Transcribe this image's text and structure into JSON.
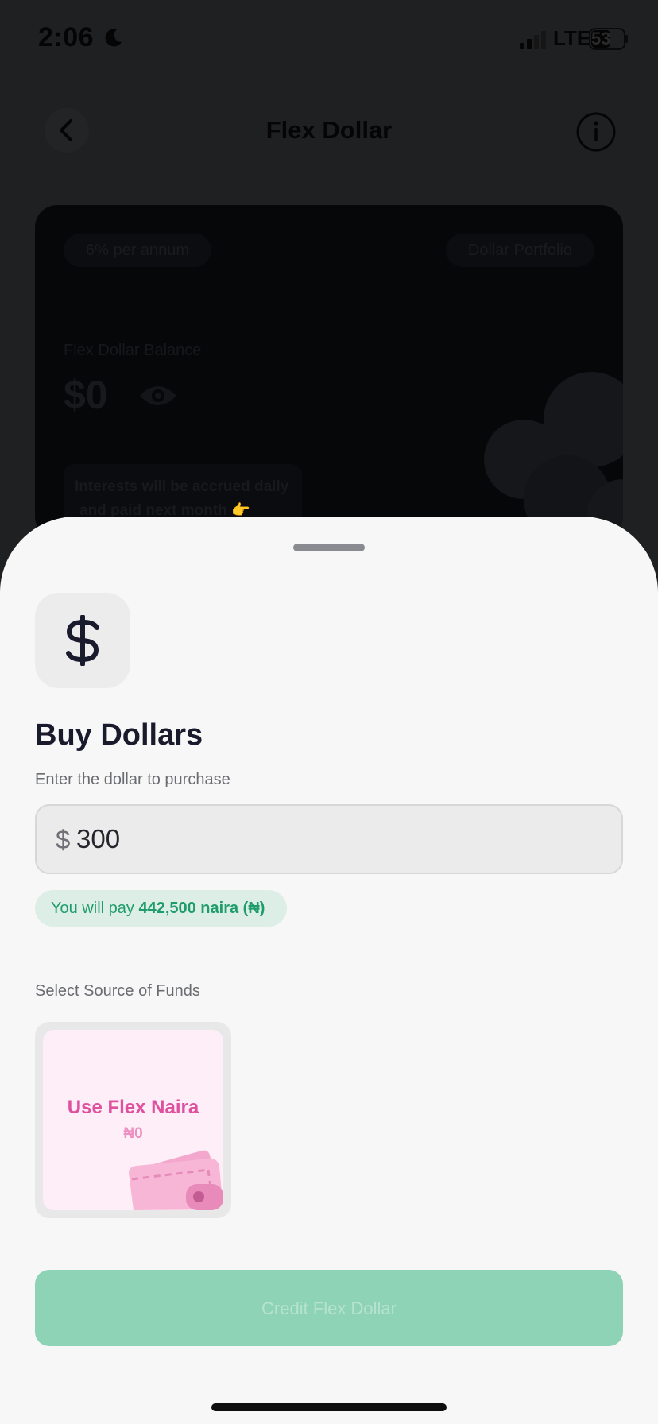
{
  "status_bar": {
    "time": "2:06",
    "network": "LTE",
    "battery": "53"
  },
  "header": {
    "title": "Flex Dollar"
  },
  "balance_card": {
    "rate_pill": "6% per annum",
    "portfolio_pill": "Dollar Portfolio",
    "balance_label": "Flex Dollar Balance",
    "balance_value": "$0",
    "interest_note_line1": "Interests will be accrued daily",
    "interest_note_line2": "and paid next month 👉"
  },
  "sheet": {
    "title": "Buy Dollars",
    "subtitle": "Enter the dollar to purchase",
    "currency_prefix": "$",
    "amount_value": "300",
    "pay_prefix": "You will pay ",
    "pay_amount": "442,500 naira (₦)",
    "source_label": "Select Source of Funds",
    "source_option": {
      "name": "Use Flex Naira",
      "balance": "₦0"
    },
    "submit_label": "Credit Flex Dollar"
  },
  "colors": {
    "primary_green": "#1e9c6a",
    "disabled_button": "#8fd3b7",
    "pink_accent": "#e0509e",
    "title_dark": "#191a2c"
  }
}
